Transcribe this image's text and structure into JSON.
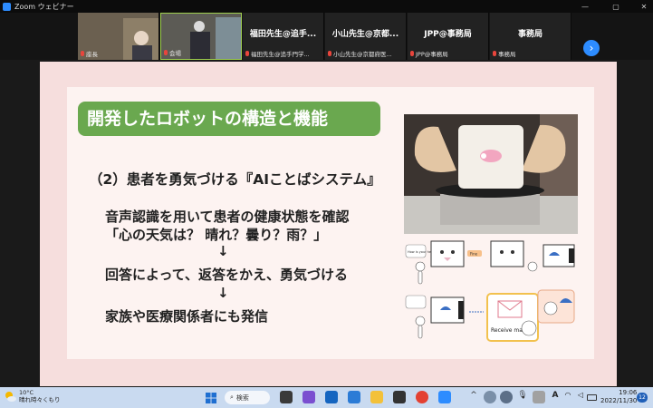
{
  "window": {
    "title": "Zoom ウェビナー"
  },
  "participants": [
    {
      "name": "",
      "subtitle": "座長",
      "video": true
    },
    {
      "name": "",
      "subtitle": "会場",
      "video": true
    },
    {
      "name": "福田先生@追手...",
      "subtitle": "福田先生@追手門学..."
    },
    {
      "name": "小山先生@京都...",
      "subtitle": "小山先生@京都府医..."
    },
    {
      "name": "JPP@事務局",
      "subtitle": "JPP@事務局"
    },
    {
      "name": "事務局",
      "subtitle": "事務局"
    }
  ],
  "slide": {
    "title": "開発したロボットの構造と機能",
    "subtitle": "（2）患者を勇気づける『AIことばシステム』",
    "lines": [
      "音声認識を用いて患者の健康状態を確認",
      "「心の天気は？ 晴れ？曇り？雨？」",
      "↓",
      "回答によって、返答をかえ、勇気づける",
      "↓",
      "家族や医療関係者にも発信"
    ],
    "diagram": {
      "bubble1": "How is your health today?",
      "bubble2": "Fine",
      "mail": "Receive ma"
    }
  },
  "taskbar": {
    "weather_temp": "10°C",
    "weather_desc": "晴れ時々くもり",
    "search": "検索",
    "time": "19:06",
    "date": "2022/11/30",
    "notifications": "12"
  },
  "colors": {
    "title_green": "#6aa84f",
    "slide_bg": "#f6dedd",
    "zoom_blue": "#2d8cff"
  }
}
